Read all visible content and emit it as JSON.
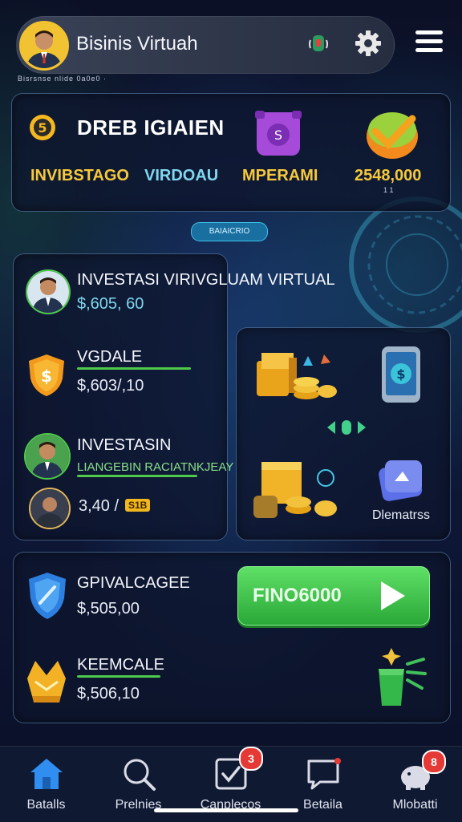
{
  "header": {
    "title": "Bisinis Virtuah",
    "subline": "Bisrsnse nlide 0a0e0 ·",
    "icons": [
      "avatar",
      "alert-icon",
      "gear-icon",
      "menu-icon"
    ]
  },
  "top_card": {
    "title": "DREB IGIAIEN",
    "label_left": "INVIBSTAGO",
    "label_mid": "VIRDOAU",
    "label_right": "MPERAMI",
    "value": "2548,000",
    "value_sub": "1 1"
  },
  "pill": "BAIAICRIO",
  "mid": {
    "row1_title": "INVESTASI VIRIVGLUAM VIRTUAL",
    "row1_value": "$,605, 60",
    "row2_title": "VGDALE",
    "row2_value": "$,603/,10",
    "row3_title": "INVESTASIN",
    "row3_sub": "LIANGEBIN RACIATNKJEAY",
    "row4_value": "3,40 /",
    "row4_chip": "S1B",
    "right_label": "Dlematrss"
  },
  "bottom": {
    "row1_title": "GPIVALCAGEE",
    "row1_value": "$,505,00",
    "row2_title": "KEEMCALE",
    "row2_value": "$,506,10",
    "button_label": "FINO6000"
  },
  "tabs": [
    {
      "label": "Batalls",
      "badge": ""
    },
    {
      "label": "Prelnies",
      "badge": ""
    },
    {
      "label": "Canplecos",
      "badge": "3"
    },
    {
      "label": "Betaila",
      "badge": ""
    },
    {
      "label": "Mlobatti",
      "badge": "8"
    }
  ],
  "colors": {
    "accent_green": "#4fc94c",
    "accent_yellow": "#f7c93a",
    "accent_cyan": "#7fd7f0",
    "badge_red": "#e53935"
  }
}
